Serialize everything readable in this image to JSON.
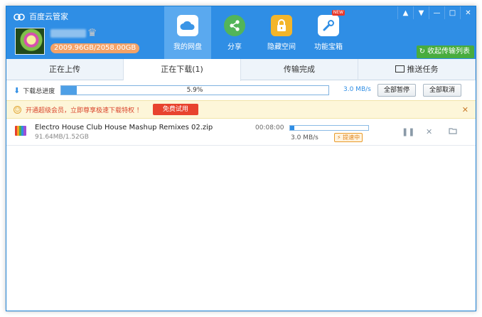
{
  "app": {
    "title": "百度云管家"
  },
  "user": {
    "quota": "2009.96GB/2058.00GB"
  },
  "nav": [
    {
      "label": "我的网盘",
      "icon": "cloud-icon",
      "active": true
    },
    {
      "label": "分享",
      "icon": "share-icon",
      "active": false
    },
    {
      "label": "隐藏空间",
      "icon": "lock-icon",
      "active": false
    },
    {
      "label": "功能宝箱",
      "icon": "tools-icon",
      "active": false,
      "badge": "NEW"
    }
  ],
  "window_controls": [
    "▲",
    "▼",
    "—",
    "□",
    "✕"
  ],
  "collapse_label": "收起传输列表",
  "tabs": [
    {
      "label": "正在上传",
      "active": false
    },
    {
      "label": "正在下载(1)",
      "active": true
    },
    {
      "label": "传输完成",
      "active": false
    },
    {
      "label": "推送任务",
      "active": false,
      "icon": "monitor-icon"
    }
  ],
  "toolbar": {
    "label": "下载总进度",
    "progress_percent": 5.9,
    "progress_text": "5.9%",
    "speed": "3.0 MB/s",
    "pause_all": "全部暂停",
    "cancel_all": "全部取消"
  },
  "banner": {
    "text": "开通超级会员，立即尊享极速下载特权 ！",
    "trial_button": "免费试用"
  },
  "downloads": [
    {
      "name": "Electro House  Club House  Mashup Remixes 02.zip",
      "size": "91.64MB/1.52GB",
      "eta": "00:08:00",
      "progress_fraction": 0.059,
      "speed": "3.0 MB/s",
      "accel_label": "提速中"
    }
  ],
  "colors": {
    "brand_blue": "#2f8ee5",
    "accent_green": "#48ac3e",
    "warning_red": "#e8432e"
  }
}
